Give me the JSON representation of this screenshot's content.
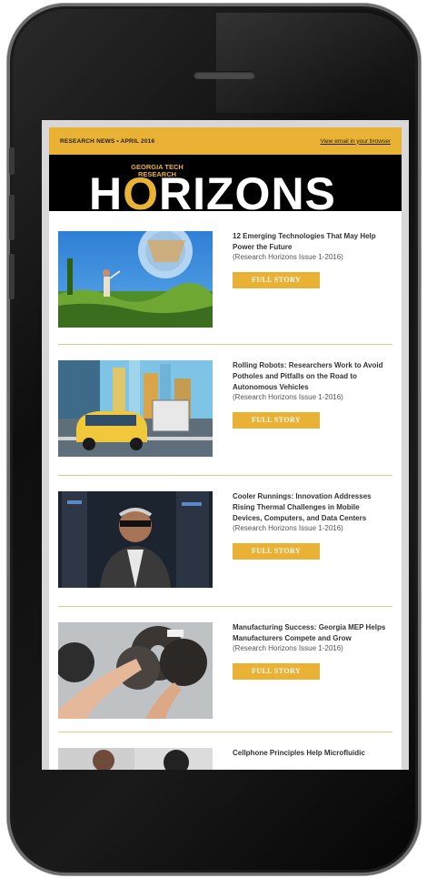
{
  "newsletter": {
    "kicker": "RESEARCH NEWS • APRIL 2016",
    "browser_link": "View email in your browser",
    "masthead_sub": "GEORGIA TECH RESEARCH",
    "masthead_brand_before": "H",
    "masthead_brand_o": "O",
    "masthead_brand_after": "RIZONS"
  },
  "stories": [
    {
      "headline": "12 Emerging Technologies That May Help Power the Future",
      "issue": "(Research Horizons Issue 1-2016)",
      "button": "FULL STORY"
    },
    {
      "headline": "Rolling Robots: Researchers Work to Avoid Potholes and Pitfalls on the Road to Autonomous Vehicles",
      "issue": "(Research Horizons Issue 1-2016)",
      "button": "FULL STORY"
    },
    {
      "headline": "Cooler Runnings: Innovation Addresses Rising Thermal Challenges in Mobile Devices, Computers, and Data Centers",
      "issue": "(Research Horizons Issue 1-2016)",
      "button": "FULL STORY"
    },
    {
      "headline": "Manufacturing Success: Georgia MEP Helps Manufacturers Compete and Grow",
      "issue": "(Research Horizons Issue 1-2016)",
      "button": "FULL STORY"
    },
    {
      "headline": "Cellphone Principles Help Microfluidic",
      "issue": ""
    }
  ],
  "colors": {
    "accent": "#e9b234",
    "phone_body": "#111111",
    "masthead_bg": "#000000"
  }
}
